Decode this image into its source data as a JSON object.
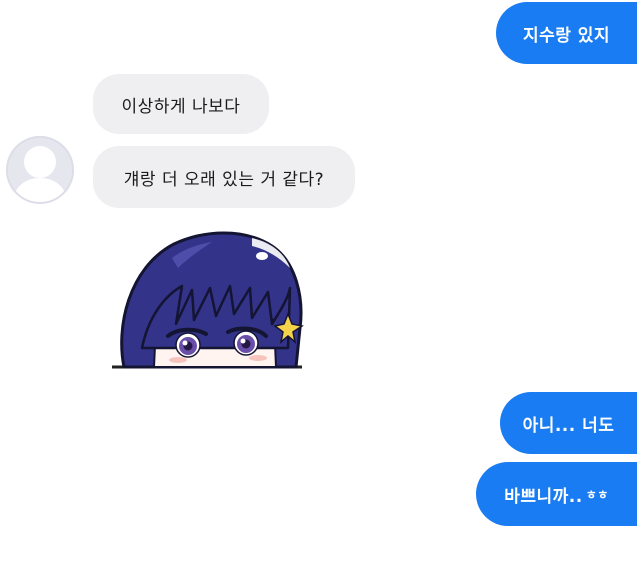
{
  "conversation": {
    "messages": [
      {
        "side": "out",
        "text": "지수랑 있지"
      },
      {
        "side": "in",
        "text": "이상하게 나보다"
      },
      {
        "side": "in",
        "text": "걔랑 더 오래 있는 거 같다?"
      },
      {
        "side": "in",
        "type": "sticker",
        "icon": "anime-girl-peeking-sticker"
      },
      {
        "side": "out",
        "text": "아니... 너도"
      },
      {
        "side": "out",
        "text": "바쁘니까..",
        "suffix": "ㅎㅎ"
      }
    ]
  },
  "contact": {
    "avatar_icon": "default-user-avatar-icon"
  },
  "colors": {
    "outgoing_bubble": "#1a7cf2",
    "incoming_bubble": "#efeff1",
    "incoming_text": "#1b1b1b",
    "outgoing_text": "#ffffff",
    "avatar_bg": "#e9eaf0",
    "sticker_hair": "#3b3b8a"
  }
}
